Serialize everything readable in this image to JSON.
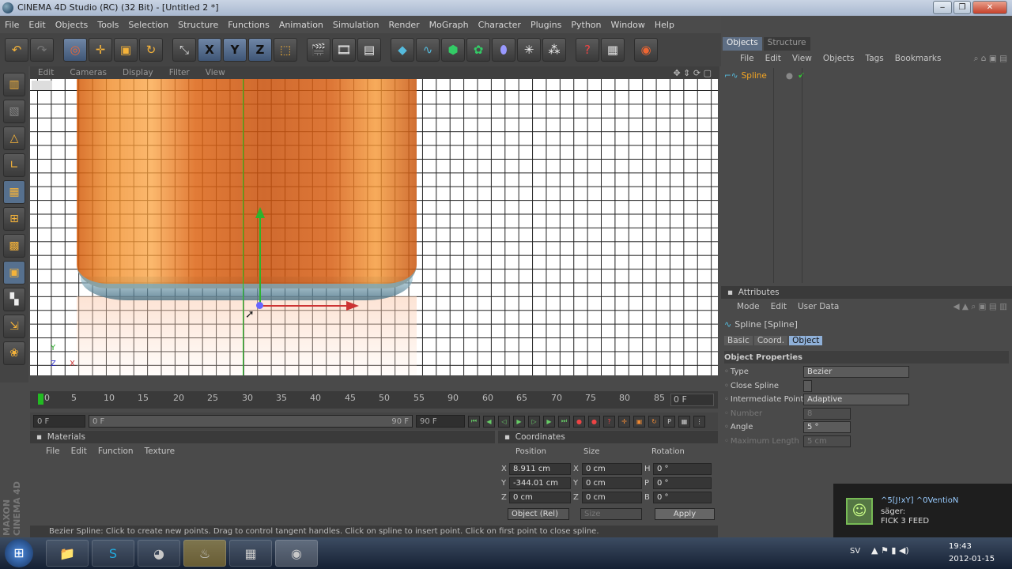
{
  "window": {
    "title": "CINEMA 4D Studio (RC) (32 Bit) - [Untitled 2 *]",
    "buttons": [
      "‒",
      "❐",
      "✕"
    ]
  },
  "menubar": [
    "File",
    "Edit",
    "Objects",
    "Tools",
    "Selection",
    "Structure",
    "Functions",
    "Animation",
    "Simulation",
    "Render",
    "MoGraph",
    "Character",
    "Plugins",
    "Python",
    "Window",
    "Help"
  ],
  "toolbar": {
    "icons": [
      "undo-icon",
      "redo-icon",
      "live-selection-icon",
      "move-icon",
      "scale-icon",
      "rotate-icon",
      "recent-tool-icon",
      "x-axis-lock-icon",
      "y-axis-lock-icon",
      "z-axis-lock-icon",
      "coordinate-system-icon",
      "render-view-icon",
      "render-picture-viewer-icon",
      "edit-render-settings-icon",
      "cube-primitive-icon",
      "spline-icon",
      "nurbs-icon",
      "array-icon",
      "deformer-icon",
      "scene-icon",
      "camera-icon",
      "light-icon",
      "help-icon",
      "script-icon",
      "web-icon"
    ],
    "axis_labels": [
      "X",
      "Y",
      "Z"
    ]
  },
  "left_tools": [
    "make-editable-icon",
    "model-icon",
    "points-icon",
    "edges-icon",
    "polygons-icon",
    "texture-icon",
    "object-axis-icon",
    "workplane-icon",
    "snapping-icon",
    "soft-selection-icon",
    "checker-icon",
    "axis-tweak-icon",
    "sculpt-icon"
  ],
  "viewport": {
    "menu": [
      "Edit",
      "Cameras",
      "Display",
      "Filter",
      "View"
    ]
  },
  "timeline": {
    "ticks": [
      "0",
      "5",
      "10",
      "15",
      "20",
      "25",
      "30",
      "35",
      "40",
      "45",
      "50",
      "55",
      "60",
      "65",
      "70",
      "75",
      "80",
      "85",
      "90"
    ],
    "current_frame": "0 F"
  },
  "playbar": {
    "start": "0 F",
    "range_start": "0 F",
    "range_end": "90 F",
    "end": "90 F"
  },
  "materials": {
    "title": "Materials",
    "menu": [
      "File",
      "Edit",
      "Function",
      "Texture"
    ]
  },
  "coordinates": {
    "title": "Coordinates",
    "headers": [
      "Position",
      "Size",
      "Rotation"
    ],
    "rows": [
      {
        "axis": "X",
        "pos": "8.911 cm",
        "size_axis": "X",
        "size": "0 cm",
        "rot_axis": "H",
        "rot": "0 °"
      },
      {
        "axis": "Y",
        "pos": "-344.01 cm",
        "size_axis": "Y",
        "size": "0 cm",
        "rot_axis": "P",
        "rot": "0 °"
      },
      {
        "axis": "Z",
        "pos": "0 cm",
        "size_axis": "Z",
        "size": "0 cm",
        "rot_axis": "B",
        "rot": "0 °"
      }
    ],
    "mode": "Object (Rel)",
    "size_mode": "Size",
    "apply": "Apply"
  },
  "status": "Bezier Spline: Click to create new points. Drag to control tangent handles. Click on spline to insert point. Click on first point to close spline.",
  "logo": "MAXON CINEMA 4D",
  "objects_panel": {
    "tabs": [
      "Objects",
      "Structure"
    ],
    "menu": [
      "File",
      "Edit",
      "View",
      "Objects",
      "Tags",
      "Bookmarks"
    ],
    "object_name": "Spline"
  },
  "attributes": {
    "title": "Attributes",
    "menu": [
      "Mode",
      "Edit",
      "User Data"
    ],
    "object": "Spline [Spline]",
    "tabs": [
      "Basic",
      "Coord.",
      "Object"
    ],
    "section": "Object Properties",
    "props": [
      {
        "label": "Type",
        "value": "Bezier"
      },
      {
        "label": "Close Spline",
        "value": ""
      },
      {
        "label": "Intermediate Points",
        "value": "Adaptive"
      },
      {
        "label": "Number",
        "value": "8"
      },
      {
        "label": "Angle",
        "value": "5 °"
      },
      {
        "label": "Maximum Length",
        "value": "5 cm"
      }
    ]
  },
  "notification": {
    "user": "^5[J!xY] ^0VentioN",
    "line1": "säger:",
    "line2": "FICK 3 FEED"
  },
  "taskbar": {
    "lang": "SV",
    "time": "19:43",
    "date": "2012-01-15"
  }
}
